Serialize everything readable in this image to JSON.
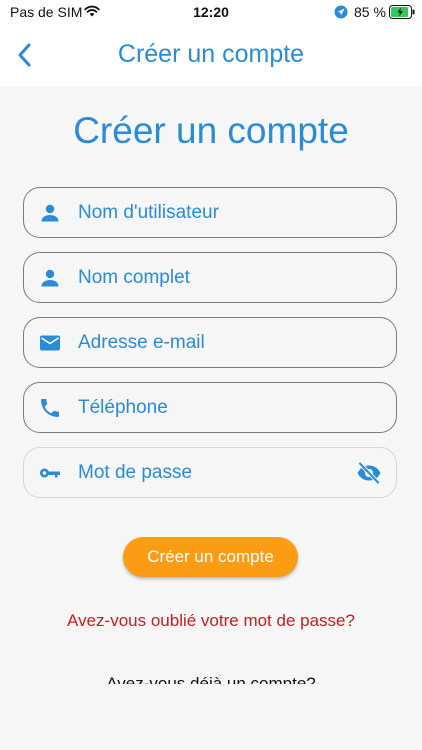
{
  "status_bar": {
    "carrier": "Pas de SIM",
    "time": "12:20",
    "battery_percent": "85 %",
    "icons": [
      "wifi-icon",
      "location-arrow-icon",
      "battery-charging-icon"
    ]
  },
  "nav": {
    "title": "Créer un compte",
    "back_icon": "chevron-left-icon"
  },
  "form": {
    "heading": "Créer un compte",
    "fields": [
      {
        "placeholder": "Nom d'utilisateur",
        "icon": "person-icon"
      },
      {
        "placeholder": "Nom complet",
        "icon": "person-icon"
      },
      {
        "placeholder": "Adresse e-mail",
        "icon": "mail-icon"
      },
      {
        "placeholder": "Téléphone",
        "icon": "phone-icon"
      },
      {
        "placeholder": "Mot de passe",
        "icon": "key-icon",
        "trailing_icon": "eye-off-icon"
      }
    ],
    "submit_label": "Créer un compte",
    "forgot_password": "Avez-vous oublié votre mot de passe?",
    "have_account": "Avez-vous déjà un compte?"
  },
  "colors": {
    "accent": "#2a8bd6",
    "button": "#fb9c12",
    "error_link": "#c41f1f",
    "background": "#f6f6f6"
  }
}
